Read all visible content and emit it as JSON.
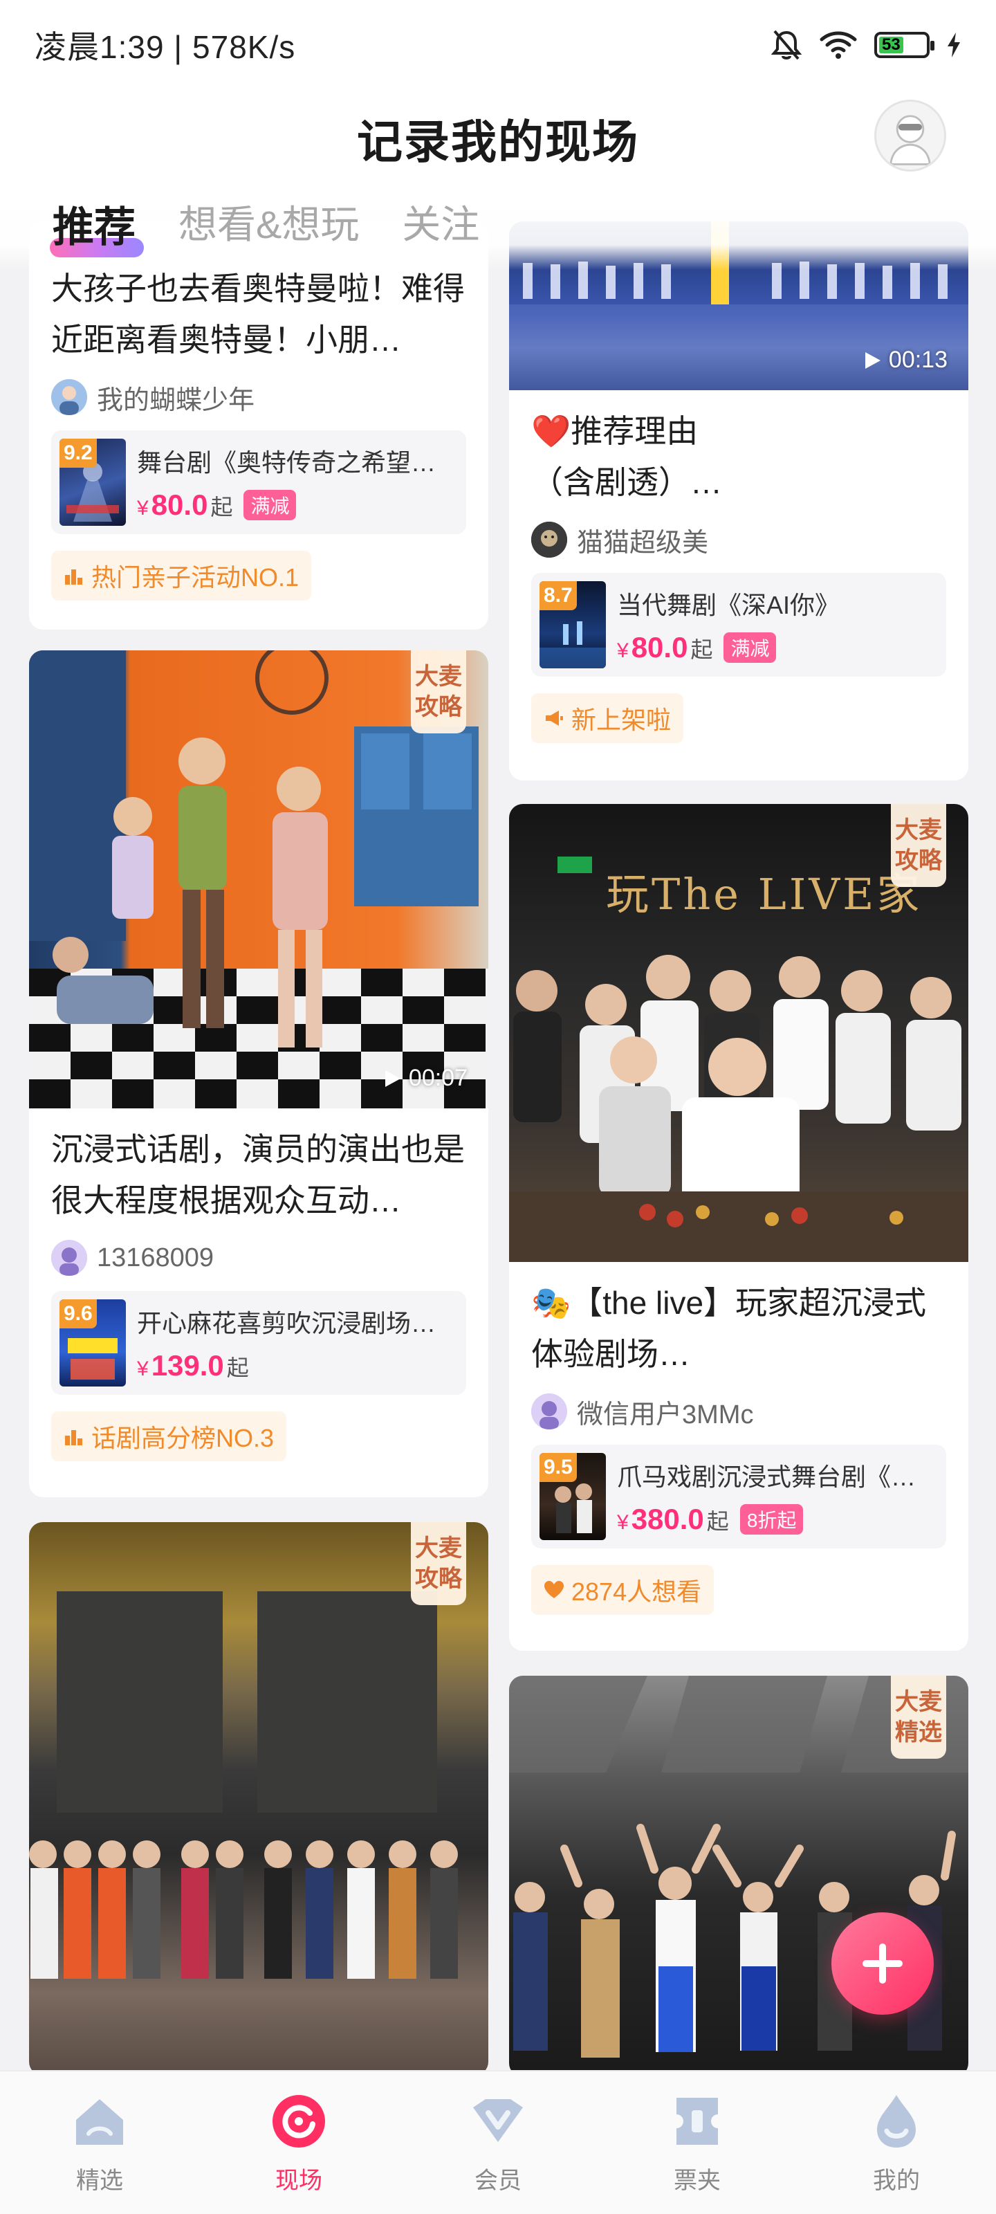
{
  "status_bar": {
    "time_speed": "凌晨1:39 | 578K/s",
    "battery_level": "53",
    "icons": [
      "mute-bell-icon",
      "wifi-icon",
      "battery-icon",
      "charging-icon"
    ]
  },
  "header": {
    "title": "记录我的现场"
  },
  "tabs": [
    {
      "label": "推荐",
      "active": true
    },
    {
      "label": "想看&想玩",
      "active": false
    },
    {
      "label": "关注",
      "active": false
    }
  ],
  "cards": {
    "c1": {
      "title": "大孩子也去看奥特曼啦！难得近距离看奥特曼！小朋…",
      "author": "我的蝴蝶少年",
      "show_score": "9.2",
      "show_name": "舞台剧《奥特传奇之希望之…",
      "price_symbol": "¥",
      "price": "80.0",
      "price_suffix": "起",
      "promo": "满减",
      "rank": "热门亲子活动NO.1"
    },
    "c2": {
      "duration": "00:13",
      "title": "❤️推荐理由\n（含剧透）…",
      "author": "猫猫超级美",
      "show_score": "8.7",
      "show_name": "当代舞剧《深AI你》",
      "price_symbol": "¥",
      "price": "80.0",
      "price_suffix": "起",
      "promo": "满减",
      "rank": "新上架啦"
    },
    "c3": {
      "badge": "大麦攻略",
      "duration": "00:07",
      "title": "沉浸式话剧，演员的演出也是很大程度根据观众互动…",
      "author": "13168009",
      "show_score": "9.6",
      "show_name": "开心麻花喜剪吹沉浸剧场《…",
      "price_symbol": "¥",
      "price": "139.0",
      "price_suffix": "起",
      "rank": "话剧高分榜NO.3"
    },
    "c4": {
      "badge": "大麦攻略",
      "sign_text": "玩The LIVE家",
      "title": "🎭【the live】玩家超沉浸式体验剧场…",
      "author": "微信用户3MMc",
      "show_score": "9.5",
      "show_name": "爪马戏剧沉浸式舞台剧《玩…",
      "price_symbol": "¥",
      "price": "380.0",
      "price_suffix": "起",
      "promo": "8折起",
      "rank": "2874人想看"
    },
    "c5": {
      "badge": "大麦攻略"
    },
    "c6": {
      "badge": "大麦精选"
    }
  },
  "bottom_nav": [
    {
      "label": "精选",
      "icon": "home-icon",
      "active": false
    },
    {
      "label": "现场",
      "icon": "live-icon",
      "active": true
    },
    {
      "label": "会员",
      "icon": "member-icon",
      "active": false
    },
    {
      "label": "票夹",
      "icon": "ticket-icon",
      "active": false
    },
    {
      "label": "我的",
      "icon": "profile-icon",
      "active": false
    }
  ],
  "colors": {
    "accent": "#ff2f63",
    "price": "#ff2f7a",
    "rank_text": "#f08a2a",
    "score_bg": "#f59a2c",
    "badge_text": "#c7643a"
  }
}
